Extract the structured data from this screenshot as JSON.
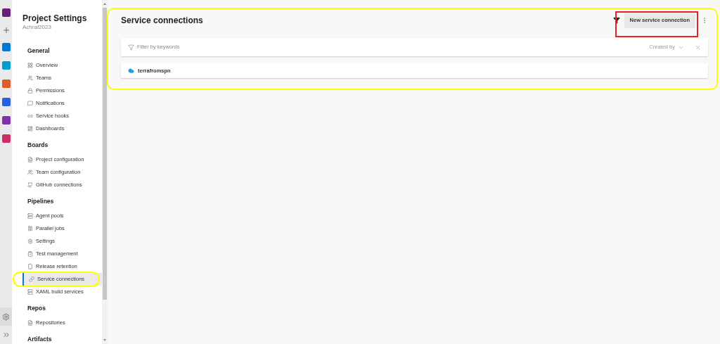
{
  "sidebar": {
    "title": "Project Settings",
    "subtitle": "Achraf2023",
    "sections": [
      {
        "title": "General",
        "items": [
          {
            "label": "Overview",
            "selected": false
          },
          {
            "label": "Teams",
            "selected": false
          },
          {
            "label": "Permissions",
            "selected": false
          },
          {
            "label": "Notifications",
            "selected": false
          },
          {
            "label": "Service hooks",
            "selected": false
          },
          {
            "label": "Dashboards",
            "selected": false
          }
        ]
      },
      {
        "title": "Boards",
        "items": [
          {
            "label": "Project configuration",
            "selected": false
          },
          {
            "label": "Team configuration",
            "selected": false
          },
          {
            "label": "GitHub connections",
            "selected": false
          }
        ]
      },
      {
        "title": "Pipelines",
        "items": [
          {
            "label": "Agent pools",
            "selected": false
          },
          {
            "label": "Parallel jobs",
            "selected": false
          },
          {
            "label": "Settings",
            "selected": false
          },
          {
            "label": "Test management",
            "selected": false
          },
          {
            "label": "Release retention",
            "selected": false
          },
          {
            "label": "Service connections",
            "selected": true
          },
          {
            "label": "XAML build services",
            "selected": false
          }
        ]
      },
      {
        "title": "Repos",
        "items": [
          {
            "label": "Repositories",
            "selected": false
          }
        ]
      },
      {
        "title": "Artifacts"
      }
    ]
  },
  "main": {
    "title": "Service connections",
    "new_button": "New service connection",
    "filter": {
      "placeholder": "Filter by keywords",
      "created_by": "Created by"
    },
    "connections": [
      {
        "name": "terrafromspn"
      }
    ]
  }
}
